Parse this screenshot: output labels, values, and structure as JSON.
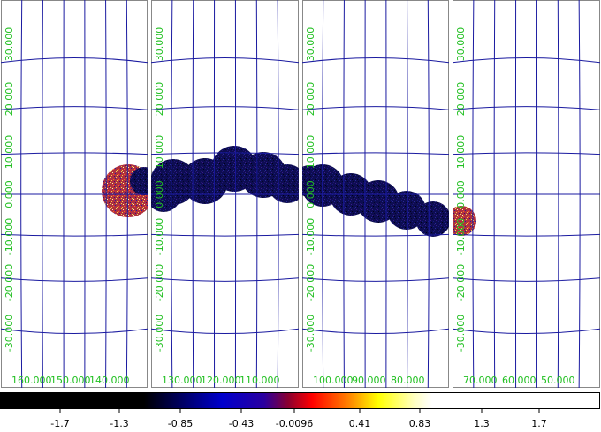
{
  "colors": {
    "grid_lines": "#1a1aa0",
    "grid_labels": "#22c022",
    "panel_background": "#ffffff",
    "panel_border": "#888888",
    "image_low": "#0b0b4a",
    "image_high": "#c8403c"
  },
  "panels": [
    {
      "name": "panel-1",
      "dec_labels": [
        "30.000",
        "20.000",
        "10.000",
        "0.000",
        "-10.000",
        "-20.000",
        "-30.000"
      ],
      "ra_labels": [
        "160.000",
        "150.000",
        "140.000"
      ]
    },
    {
      "name": "panel-2",
      "dec_labels": [
        "30.000",
        "20.000",
        "10.000",
        "0.000",
        "-10.000",
        "-20.000",
        "-30.000"
      ],
      "ra_labels": [
        "130.000",
        "120.000",
        "110.000"
      ]
    },
    {
      "name": "panel-3",
      "dec_labels": [
        "30.000",
        "20.000",
        "10.000",
        "0.000",
        "-10.000",
        "-20.000",
        "-30.000"
      ],
      "ra_labels": [
        "100.000",
        "90.000",
        "80.000"
      ]
    },
    {
      "name": "panel-4",
      "dec_labels": [
        "30.000",
        "20.000",
        "10.000",
        "0.000",
        "-10.000",
        "-20.000",
        "-30.000"
      ],
      "ra_labels": [
        "70.000",
        "60.000",
        "50.000"
      ]
    }
  ],
  "colorbar": {
    "colormap": "heat (black-blue-red-yellow-white)",
    "ticks": [
      "-1.7",
      "-1.3",
      "-0.85",
      "-0.43",
      "-0.0096",
      "0.41",
      "0.83",
      "1.3",
      "1.7"
    ]
  }
}
